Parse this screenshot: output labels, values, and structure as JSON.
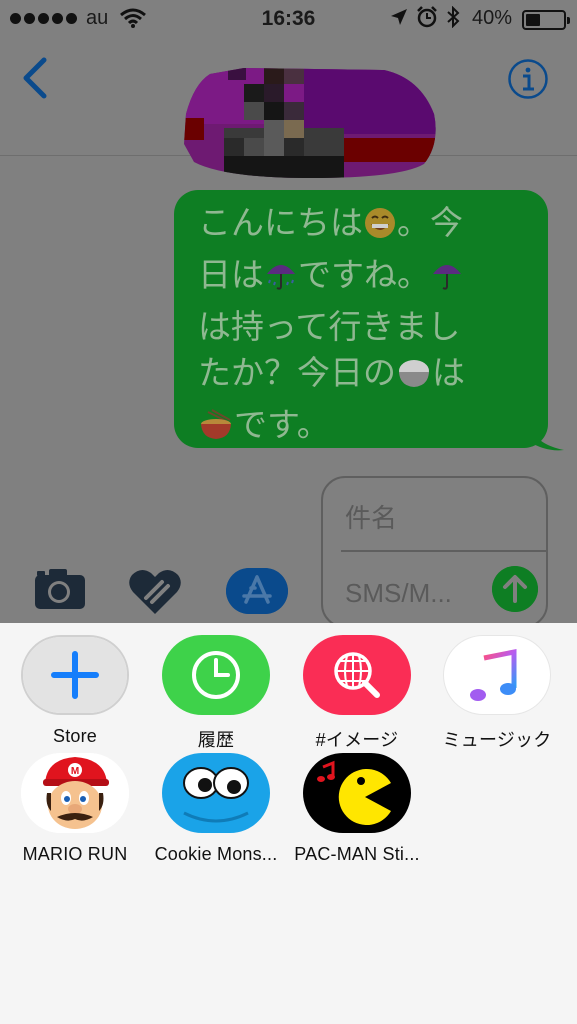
{
  "status_bar": {
    "carrier": "au",
    "time": "16:36",
    "battery_percent_text": "40%",
    "battery_level": 0.4
  },
  "conversation": {
    "message_lines": [
      [
        "こんにちは",
        {
          "emoji": "grinning-face-emoji"
        },
        "。今"
      ],
      [
        "日は",
        {
          "emoji": "umbrella-rain-emoji"
        },
        "ですね。",
        {
          "emoji": "umbrella-emoji"
        }
      ],
      [
        "は持って行きまし"
      ],
      [
        "たか？今日の",
        {
          "emoji": "rice-emoji"
        },
        "は"
      ],
      [
        {
          "emoji": "ramen-emoji"
        },
        "です。"
      ]
    ]
  },
  "compose": {
    "subject_placeholder": "件名",
    "message_placeholder": "SMS/M..."
  },
  "apps": [
    {
      "label": "Store",
      "icon": "plus-icon",
      "color": "#e3e3e3"
    },
    {
      "label": "履歴",
      "icon": "clock-icon",
      "color": "#3ed24a"
    },
    {
      "label": "#イメージ",
      "icon": "globe-search-icon",
      "color": "#fa2d55"
    },
    {
      "label": "ミュージック",
      "icon": "music-note-icon",
      "color": "#ffffff"
    },
    {
      "label": "MARIO RUN",
      "icon": "mario-icon",
      "color": "#ffffff"
    },
    {
      "label": "Cookie Mons...",
      "icon": "cookie-monster-icon",
      "color": "#1aa3e8"
    },
    {
      "label": "PAC-MAN Sti...",
      "icon": "pacman-icon",
      "color": "#000000"
    }
  ],
  "colors": {
    "accent": "#157efb",
    "bubble_green": "#0e7e23",
    "dim_overlay": "#808080",
    "drawer_bg": "#f5f5f5"
  }
}
